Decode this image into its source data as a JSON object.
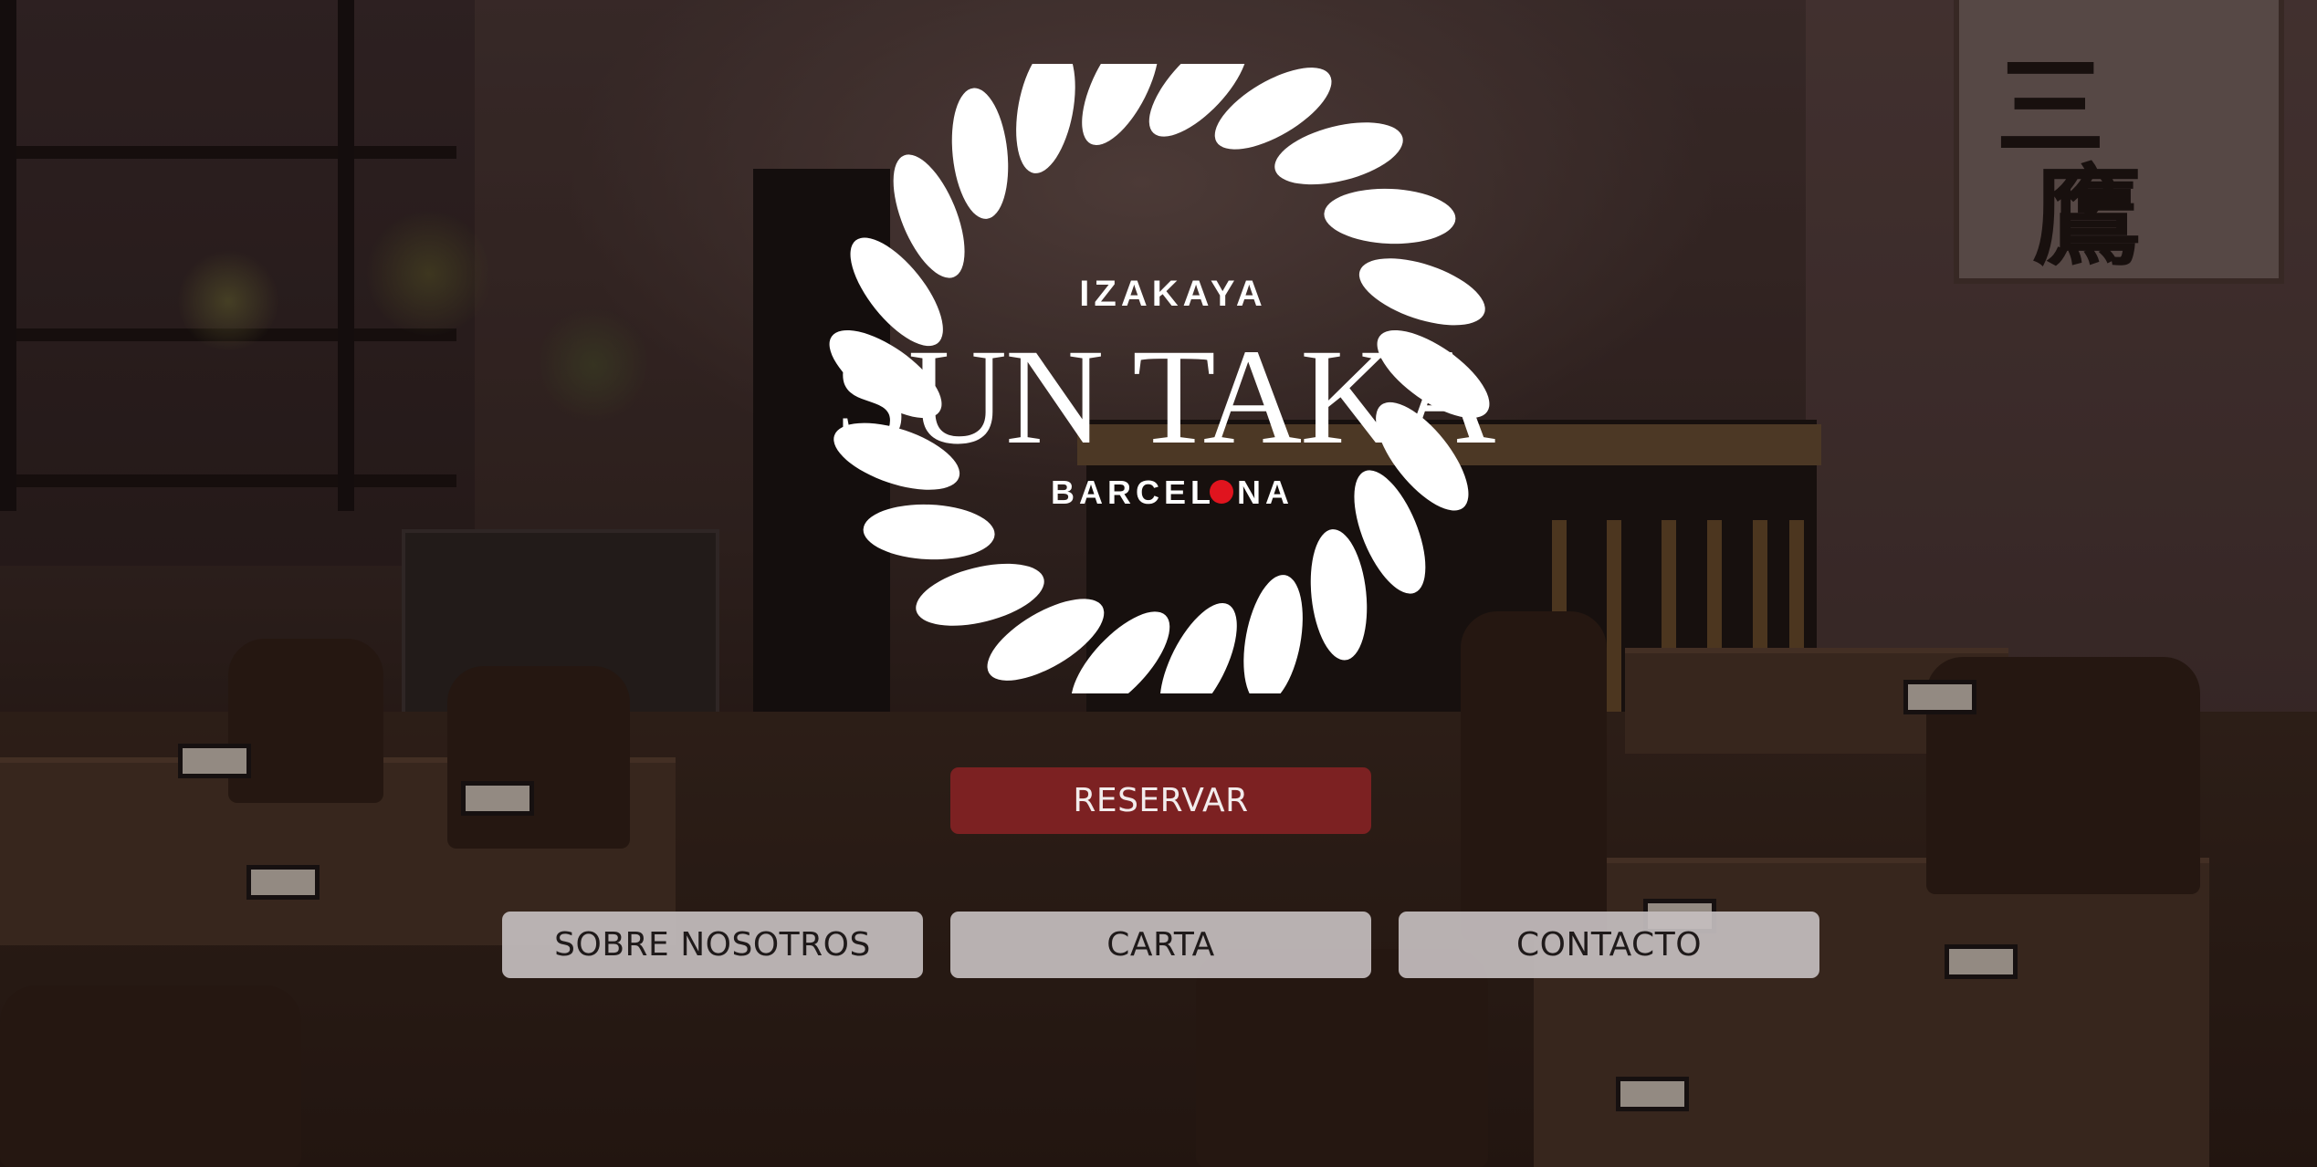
{
  "logo": {
    "top_text": "IZAKAYA",
    "name": "SUN TAKA",
    "city_part1": "BARCEL",
    "city_part2": "NA",
    "accent_color": "#e0141e"
  },
  "actions": {
    "reserve_label": "RESERVAR",
    "about_label": "SOBRE NOSOTROS",
    "menu_label": "CARTA",
    "contact_label": "CONTACTO"
  },
  "colors": {
    "primary_button": "#7c2122",
    "secondary_button": "#c4bebf"
  },
  "background": {
    "art_glyphs": [
      "三",
      "鷹"
    ]
  }
}
